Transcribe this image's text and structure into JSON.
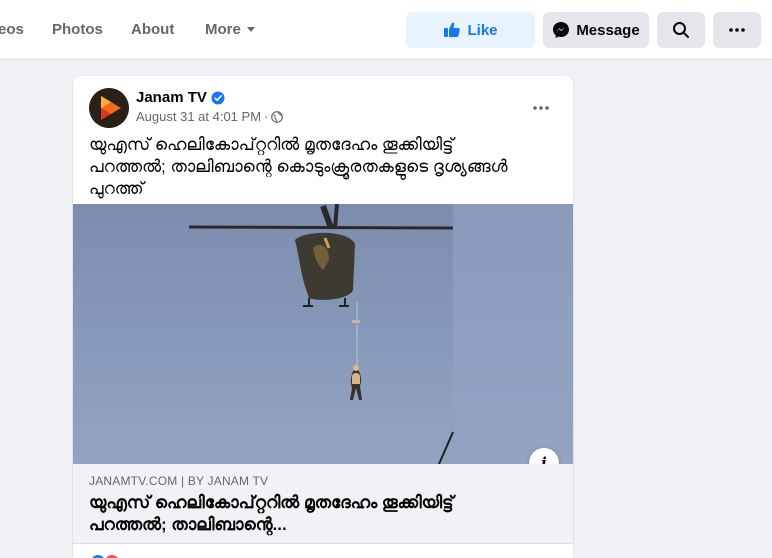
{
  "nav": {
    "tabs": [
      {
        "label": "eos"
      },
      {
        "label": "Photos"
      },
      {
        "label": "About"
      },
      {
        "label": "More"
      }
    ],
    "actions": {
      "like_label": "Like",
      "message_label": "Message"
    }
  },
  "post": {
    "page_name": "Janam TV",
    "timestamp": "August 31 at 4:01 PM",
    "separator": "·",
    "text": "യുഎസ് ഹെലികോപ്റ്ററില്‍ മൃതദേഹം തൂക്കിയിട്ട് പറത്തല്‍; താലിബാന്റെ കൊടുംക്രൂരതകളുടെ ദൃശ്യങ്ങള്‍ പുറത്ത്",
    "info_label": "i",
    "link": {
      "domain": "JANAMTV.COM | BY JANAM TV",
      "title": "യുഎസ് ഹെലികോപ്റ്ററില്‍ മൃതദേഹം തൂക്കിയിട്ട് പറത്തല്‍; താലിബാന്റെ..."
    }
  },
  "colors": {
    "accent": "#1877f2",
    "like_bg": "#e7f3ff",
    "button_bg": "#e4e6eb",
    "page_bg": "#f0f2f5"
  },
  "icons": [
    "thumbs-up-icon",
    "messenger-icon",
    "search-icon",
    "more-dots-icon",
    "verified-badge-icon",
    "globe-icon",
    "info-icon"
  ]
}
